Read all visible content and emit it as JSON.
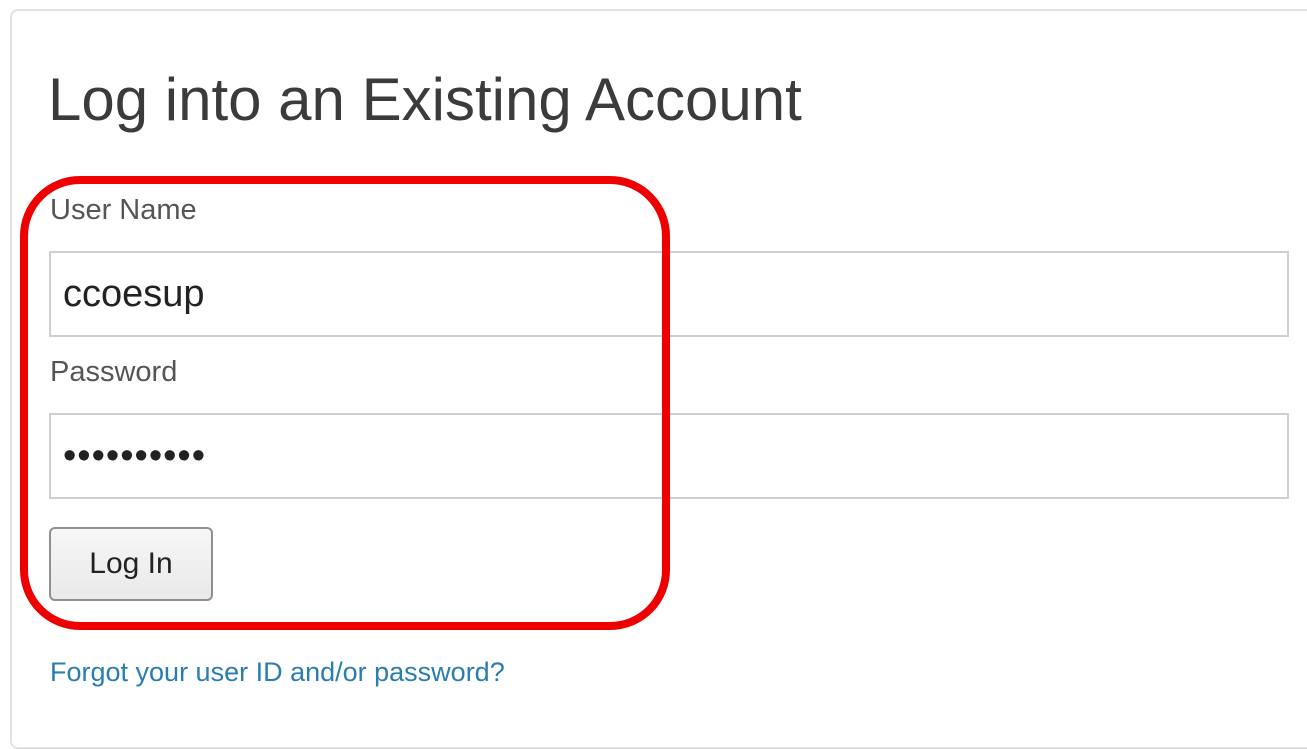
{
  "login": {
    "title": "Log into an Existing Account",
    "username_label": "User Name",
    "username_value": "ccoesup",
    "password_label": "Password",
    "password_value": "••••••••••",
    "submit_label": "Log In",
    "forgot_link": "Forgot your user ID and/or password?"
  },
  "colors": {
    "highlight": "#ee0000",
    "link": "#2a7db0",
    "title_text": "#3b3b3b"
  }
}
